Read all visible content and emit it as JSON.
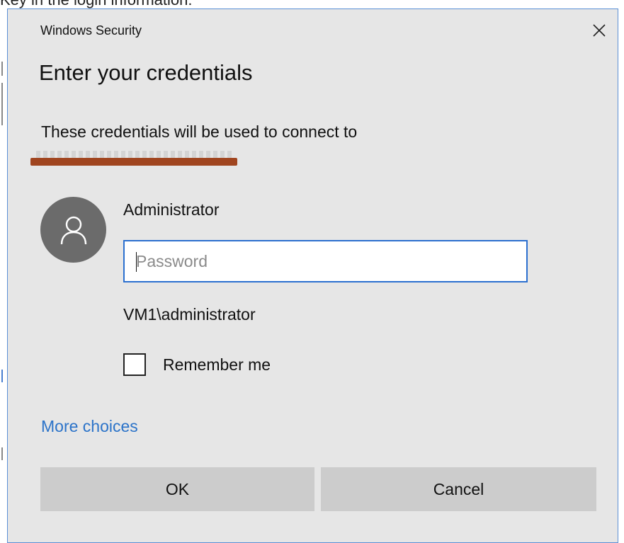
{
  "background": {
    "text": "Key in the login information:"
  },
  "dialog": {
    "window_title": "Windows Security",
    "close_icon": "close-icon",
    "heading": "Enter your credentials",
    "description": "These credentials will be used to connect to",
    "redacted_host": "[redacted hostname]",
    "account": {
      "avatar_icon": "user-icon",
      "username": "Administrator",
      "password_placeholder": "Password",
      "password_value": "",
      "domain_user": "VM1\\administrator"
    },
    "remember_me": {
      "label": "Remember me",
      "checked": false
    },
    "more_choices_label": "More choices",
    "buttons": {
      "ok_label": "OK",
      "cancel_label": "Cancel"
    }
  },
  "colors": {
    "dialog_bg": "#e6e6e6",
    "border_accent": "#5b8fd6",
    "input_focus": "#2b6fcf",
    "link": "#2b73c9",
    "button_bg": "#cccccc",
    "avatar_bg": "#6b6b6b",
    "redaction": "#a0451f"
  }
}
